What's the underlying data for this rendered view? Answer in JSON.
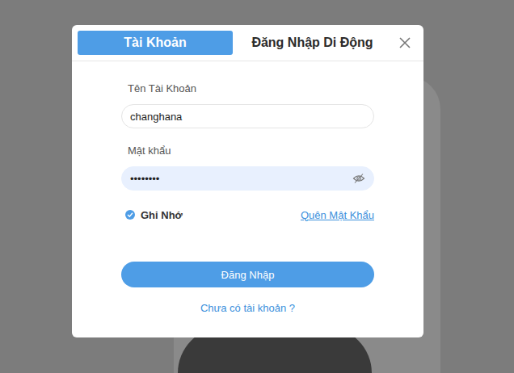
{
  "tabs": [
    {
      "label": "Tài Khoản",
      "selected": true
    },
    {
      "label": "Đăng Nhập Di Động",
      "selected": false
    }
  ],
  "username": {
    "label": "Tên Tài Khoản",
    "value": "changhana"
  },
  "password": {
    "label": "Mật khẩu",
    "value": "••••••••"
  },
  "remember": {
    "label": "Ghi Nhớ",
    "checked": true
  },
  "forgot_link": "Quên Mật Khẩu",
  "login_button": "Đăng Nhập",
  "signup_link": "Chưa có tài khoản ?"
}
